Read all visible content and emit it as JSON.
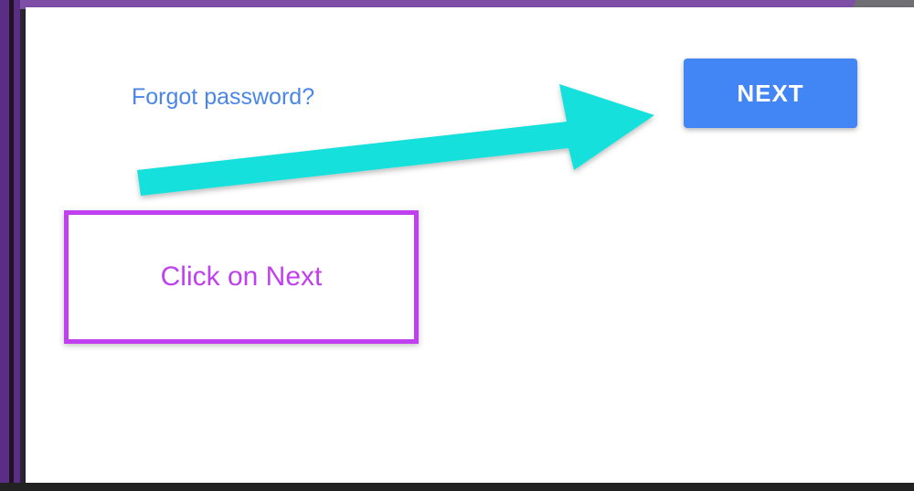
{
  "login": {
    "forgot_password_label": "Forgot password?",
    "next_label": "NEXT"
  },
  "annotation": {
    "callout_text": "Click on Next",
    "arrow_icon": "arrow-right-icon",
    "colors": {
      "arrow": "#14e0dc",
      "callout_border": "#c040f0",
      "callout_text": "#c040f0"
    }
  },
  "colors": {
    "button_bg": "#4285f4",
    "link": "#4a86e8",
    "frame_purple": "#7e4fa7"
  }
}
